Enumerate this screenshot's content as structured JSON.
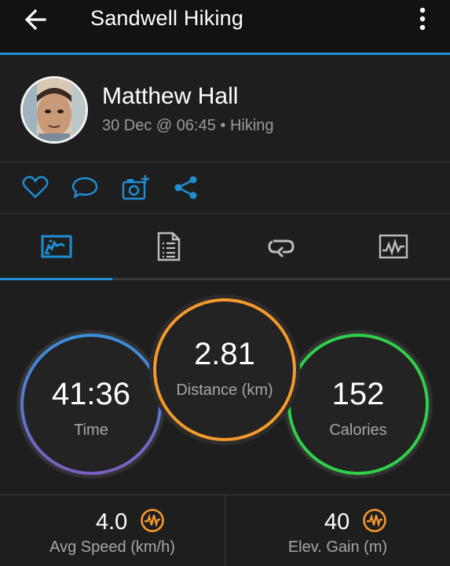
{
  "appbar": {
    "title": "Sandwell Hiking",
    "back_icon": "arrow-left-icon",
    "menu_icon": "more-vertical-icon"
  },
  "profile": {
    "name": "Matthew Hall",
    "meta": "30 Dec @ 06:45 • Hiking"
  },
  "actions": [
    {
      "icon": "heart-icon"
    },
    {
      "icon": "comment-icon"
    },
    {
      "icon": "add-photo-icon"
    },
    {
      "icon": "share-icon"
    }
  ],
  "tabs": [
    {
      "icon": "map-icon",
      "active": true
    },
    {
      "icon": "details-icon",
      "active": false
    },
    {
      "icon": "laps-icon",
      "active": false
    },
    {
      "icon": "charts-icon",
      "active": false
    }
  ],
  "stats": {
    "time": {
      "value": "41:36",
      "label": "Time"
    },
    "distance": {
      "value": "2.81",
      "label": "Distance (km)"
    },
    "calories": {
      "value": "152",
      "label": "Calories"
    }
  },
  "bottom": {
    "avg_speed": {
      "value": "4.0",
      "label": "Avg Speed (km/h)"
    },
    "elev_gain": {
      "value": "40",
      "label": "Elev. Gain (m)"
    }
  },
  "colors": {
    "accent": "#1e8fd6",
    "orange": "#f39a2b",
    "green": "#2ed14a",
    "time_gradient_top": "#3a8fdc",
    "time_gradient_bottom": "#7b5fc2"
  }
}
